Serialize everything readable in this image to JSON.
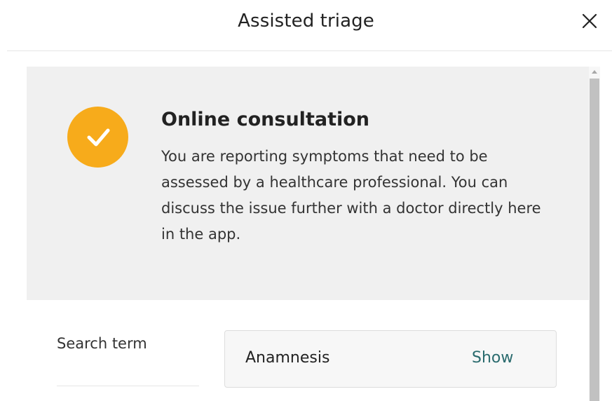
{
  "header": {
    "title": "Assisted triage",
    "close_icon": "close-icon"
  },
  "banner": {
    "icon": "checkmark-circle-icon",
    "icon_color": "#f7ab1b",
    "title": "Online consultation",
    "body": "You are reporting symptoms that need to be assessed by a healthcare professional. You can discuss the issue further with a doctor directly here in the app."
  },
  "details": {
    "search_term_label": "Search term",
    "anamnesis_label": "Anamnesis",
    "show_label": "Show",
    "link_color": "#2a6b6e"
  }
}
